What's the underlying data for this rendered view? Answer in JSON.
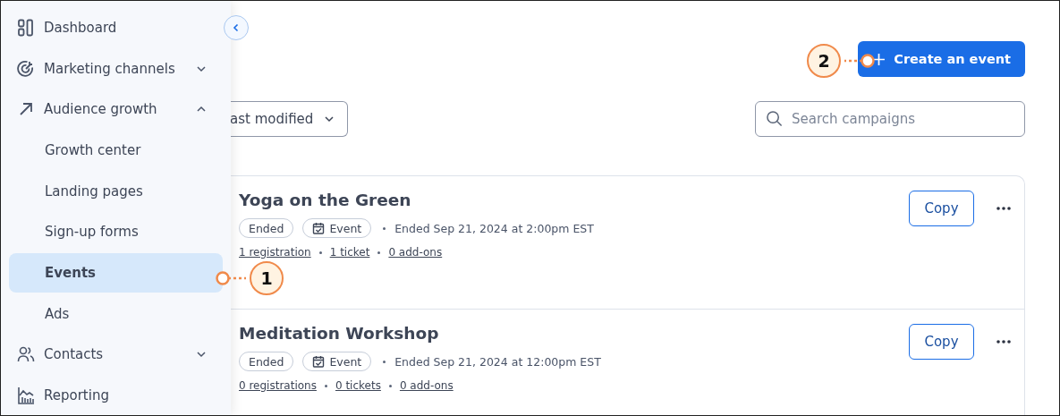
{
  "sidebar": {
    "items": [
      {
        "kind": "top",
        "label": "Dashboard",
        "selected": false
      },
      {
        "kind": "top",
        "label": "Marketing channels",
        "expanded": false,
        "selected": false
      },
      {
        "kind": "top",
        "label": "Audience growth",
        "expanded": true,
        "selected": false
      },
      {
        "kind": "sub",
        "label": "Growth center",
        "selected": false
      },
      {
        "kind": "sub",
        "label": "Landing pages",
        "selected": false
      },
      {
        "kind": "sub",
        "label": "Sign-up forms",
        "selected": false
      },
      {
        "kind": "sub",
        "label": "Events",
        "selected": true
      },
      {
        "kind": "sub",
        "label": "Ads",
        "selected": false
      },
      {
        "kind": "top",
        "label": "Contacts",
        "expanded": false,
        "selected": false
      },
      {
        "kind": "top",
        "label": "Reporting",
        "selected": false
      }
    ]
  },
  "create_button": {
    "label": "Create an event"
  },
  "sort_dropdown": {
    "value": "ast modified"
  },
  "search": {
    "placeholder": "Search campaigns"
  },
  "events": [
    {
      "title": "Yoga on the Green",
      "status": "Ended",
      "type": "Event",
      "date": "Ended Sep 21, 2024 at 2:00pm EST",
      "links": [
        "1 registration",
        "1 ticket",
        "0 add-ons"
      ],
      "copy": "Copy"
    },
    {
      "title": "Meditation Workshop",
      "status": "Ended",
      "type": "Event",
      "date": "Ended Sep 21, 2024 at 12:00pm EST",
      "links": [
        "0 registrations",
        "0 tickets",
        "0 add-ons"
      ],
      "copy": "Copy"
    }
  ],
  "callouts": [
    {
      "label": "1"
    },
    {
      "label": "2"
    }
  ]
}
